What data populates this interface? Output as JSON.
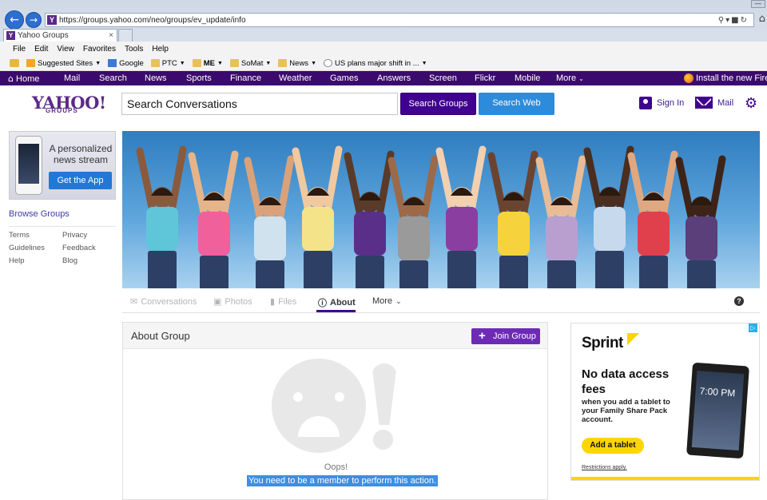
{
  "browser": {
    "url_prefix": "https://groups.",
    "url_host": "yahoo.com",
    "url_path": "/neo/groups/ev_update/info",
    "tab_title": "Yahoo Groups",
    "menu": [
      "File",
      "Edit",
      "View",
      "Favorites",
      "Tools",
      "Help"
    ],
    "favorites": [
      {
        "label": "Suggested Sites",
        "icon": "suggested-sites-icon",
        "dropdown": true
      },
      {
        "label": "Google",
        "icon": "google-icon",
        "dropdown": false
      },
      {
        "label": "PTC",
        "icon": "folder-icon",
        "dropdown": true
      },
      {
        "label": "ME",
        "icon": "folder-icon",
        "dropdown": true
      },
      {
        "label": "SoMat",
        "icon": "folder-icon",
        "dropdown": true
      },
      {
        "label": "News",
        "icon": "folder-icon",
        "dropdown": true
      },
      {
        "label": "US plans major shift in ...",
        "icon": "page-icon",
        "dropdown": true
      }
    ]
  },
  "ynav": {
    "items": [
      "Home",
      "Mail",
      "Search",
      "News",
      "Sports",
      "Finance",
      "Weather",
      "Games",
      "Answers",
      "Screen",
      "Flickr",
      "Mobile",
      "More"
    ],
    "firefox": "Install the new Firef"
  },
  "header": {
    "logo": "YAHOO!",
    "logo_sub": "GROUPS",
    "search_value": "Search Conversations",
    "search_groups": "Search Groups",
    "search_web": "Search Web",
    "sign_in": "Sign In",
    "mail": "Mail"
  },
  "sidebar": {
    "promo_text": "A personalized news stream",
    "promo_button": "Get the App",
    "browse": "Browse Groups",
    "links": [
      "Terms",
      "Privacy",
      "Guidelines",
      "Feedback",
      "Help",
      "Blog"
    ]
  },
  "group_tabs": {
    "conversations": "Conversations",
    "photos": "Photos",
    "files": "Files",
    "about": "About",
    "more": "More"
  },
  "about": {
    "title": "About Group",
    "join": "Join Group",
    "oops": "Oops!",
    "message": "You need to be a member to perform this action."
  },
  "ad": {
    "brand": "Sprint",
    "headline": "No data access fees",
    "sub": "when you add a tablet to your Family Share Pack account.",
    "button": "Add a tablet",
    "restrictions": "Restrictions apply.",
    "tablet_time": "7:00 PM"
  },
  "colors": {
    "yahoo_purple": "#400090",
    "nav_purple": "#3b0a6e",
    "search_web_blue": "#2d8bdc",
    "sprint_yellow": "#ffd500"
  }
}
